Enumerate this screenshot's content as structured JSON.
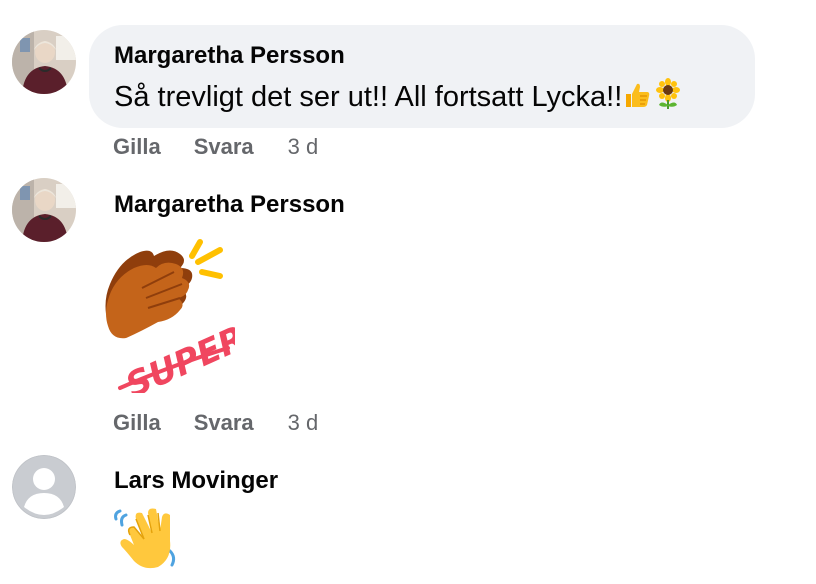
{
  "comments": [
    {
      "author": "Margaretha Persson",
      "text": "Så trevligt det ser ut!! All fortsatt Lycka!!",
      "emojis": [
        "thumbs-up",
        "sunflower"
      ],
      "actions": {
        "like": "Gilla",
        "reply": "Svara",
        "time": "3 d"
      }
    },
    {
      "author": "Margaretha Persson",
      "sticker": {
        "text": "SUPER!",
        "icon": "clapping-hands-sticker"
      },
      "actions": {
        "like": "Gilla",
        "reply": "Svara",
        "time": "3 d"
      }
    },
    {
      "author": "Lars Movinger",
      "emoji": "waving-hand"
    }
  ],
  "colors": {
    "bubble": "#f0f2f5",
    "text": "#050505",
    "secondary": "#65676b",
    "sticker_pink": "#f0465f",
    "sticker_yellow": "#ffc000",
    "hand_brown": "#c4641a"
  }
}
